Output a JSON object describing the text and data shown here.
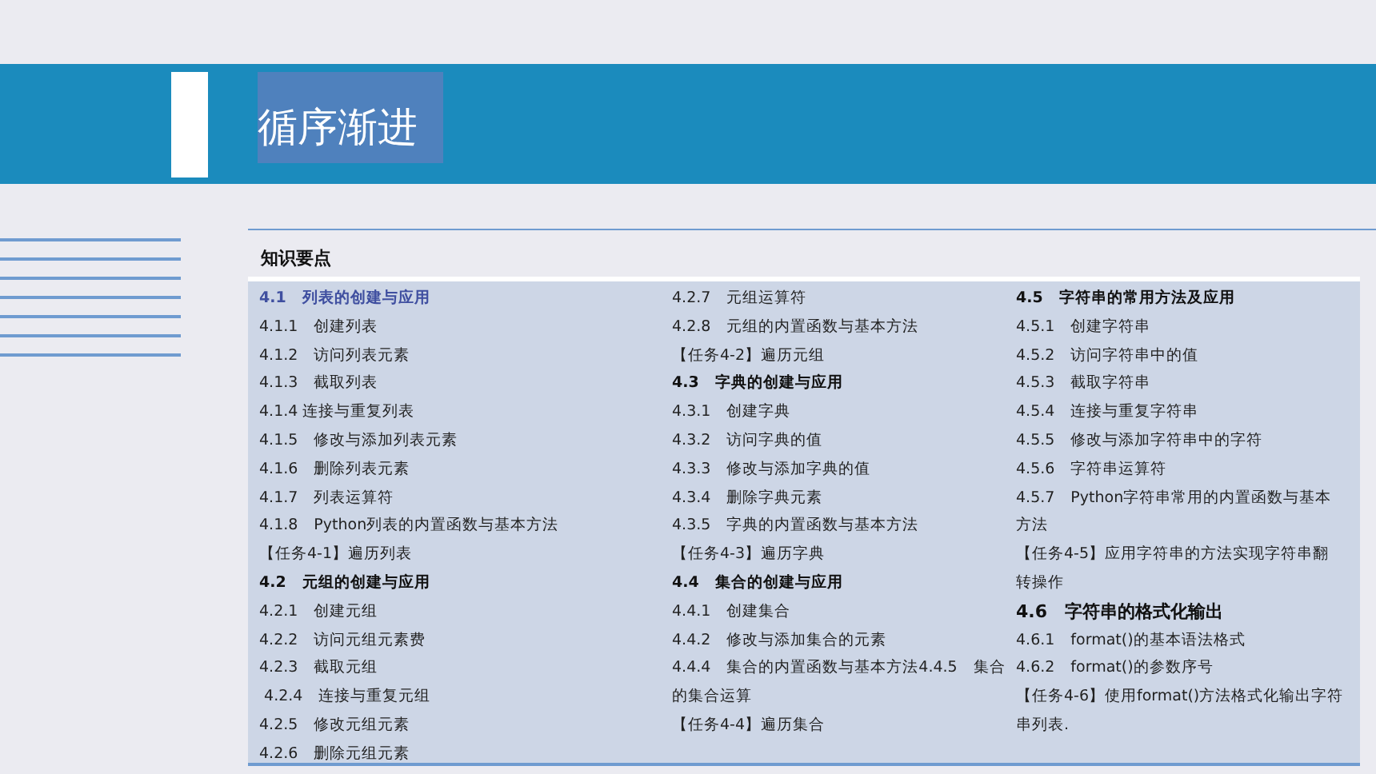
{
  "banner": {
    "title": "循序渐进"
  },
  "section": {
    "title": "知识要点",
    "columns": [
      [
        {
          "kind": "heading-current",
          "text": "4.1　列表的创建与应用"
        },
        {
          "kind": "item",
          "text": "4.1.1　创建列表"
        },
        {
          "kind": "item",
          "text": "4.1.2　访问列表元素"
        },
        {
          "kind": "item",
          "text": "4.1.3　截取列表"
        },
        {
          "kind": "item",
          "text": "4.1.4 连接与重复列表"
        },
        {
          "kind": "item",
          "text": "4.1.5　修改与添加列表元素"
        },
        {
          "kind": "item",
          "text": "4.1.6　删除列表元素"
        },
        {
          "kind": "item",
          "text": "4.1.7　列表运算符"
        },
        {
          "kind": "item",
          "text": "4.1.8　Python列表的内置函数与基本方法"
        },
        {
          "kind": "item",
          "text": "【任务4-1】遍历列表"
        },
        {
          "kind": "heading",
          "text": "4.2　元组的创建与应用"
        },
        {
          "kind": "item",
          "text": "4.2.1　创建元组"
        },
        {
          "kind": "item",
          "text": "4.2.2　访问元组元素费"
        },
        {
          "kind": "item",
          "text": "4.2.3　截取元组"
        },
        {
          "kind": "item",
          "text": " 4.2.4　连接与重复元组"
        },
        {
          "kind": "item",
          "text": "4.2.5　修改元组元素"
        },
        {
          "kind": "item",
          "text": "4.2.6　删除元组元素"
        }
      ],
      [
        {
          "kind": "item",
          "text": "4.2.7　元组运算符"
        },
        {
          "kind": "item",
          "text": "4.2.8　元组的内置函数与基本方法"
        },
        {
          "kind": "item",
          "text": "【任务4-2】遍历元组"
        },
        {
          "kind": "heading",
          "text": "4.3　字典的创建与应用"
        },
        {
          "kind": "item",
          "text": "4.3.1　创建字典"
        },
        {
          "kind": "item",
          "text": "4.3.2　访问字典的值"
        },
        {
          "kind": "item",
          "text": "4.3.3　修改与添加字典的值"
        },
        {
          "kind": "item",
          "text": "4.3.4　删除字典元素"
        },
        {
          "kind": "item",
          "text": "4.3.5　字典的内置函数与基本方法"
        },
        {
          "kind": "item",
          "text": "【任务4-3】遍历字典"
        },
        {
          "kind": "heading",
          "text": "4.4　集合的创建与应用"
        },
        {
          "kind": "item",
          "text": "4.4.1　创建集合"
        },
        {
          "kind": "item",
          "text": "4.4.2　修改与添加集合的元素"
        },
        {
          "kind": "item",
          "text": "4.4.4　集合的内置函数与基本方法4.4.5　集合的集合运算"
        },
        {
          "kind": "item",
          "text": "【任务4-4】遍历集合"
        }
      ],
      [
        {
          "kind": "heading",
          "text": "4.5　字符串的常用方法及应用"
        },
        {
          "kind": "item",
          "text": "4.5.1　创建字符串"
        },
        {
          "kind": "item",
          "text": "4.5.2　访问字符串中的值"
        },
        {
          "kind": "item",
          "text": "4.5.3　截取字符串"
        },
        {
          "kind": "item",
          "text": "4.5.4　连接与重复字符串"
        },
        {
          "kind": "item",
          "text": "4.5.5　修改与添加字符串中的字符"
        },
        {
          "kind": "item",
          "text": "4.5.6　字符串运算符"
        },
        {
          "kind": "item",
          "text": "4.5.7　Python字符串常用的内置函数与基本方法"
        },
        {
          "kind": "item",
          "text": "【任务4-5】应用字符串的方法实现字符串翻转操作"
        },
        {
          "kind": "heading-large",
          "text": "4.6　字符串的格式化输出"
        },
        {
          "kind": "item",
          "text": "4.6.1　format()的基本语法格式"
        },
        {
          "kind": "item",
          "text": "4.6.2　format()的参数序号"
        },
        {
          "kind": "item",
          "text": "【任务4-6】使用format()方法格式化输出字符串列表."
        }
      ]
    ]
  }
}
